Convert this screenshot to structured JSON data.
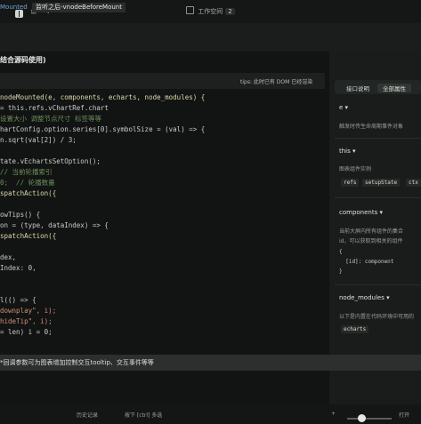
{
  "window": {
    "title": "工作空间",
    "badge": "2"
  },
  "toolbar": {
    "list_icon": "≡",
    "back_icon": "‹"
  },
  "heading": "结合源码使用)",
  "editor": {
    "tab_a": "Mounted",
    "tab_b": "监听之后-vnodeBeforeMount",
    "tip": "tips: 此时已有 DOM 已经渲染"
  },
  "code_lines": [
    {
      "p": "nodeMounted(e, components, echarts, node_modules) {",
      "c": "fn"
    },
    {
      "p": "= this.refs.vChartRef.chart",
      "c": ""
    },
    {
      "p": "设置大小 调整节点尺寸 标签等等",
      "c": "cm"
    },
    {
      "p": "hartConfig.option.series[0].symbolSize = (val) => {",
      "c": ""
    },
    {
      "p": "n.sqrt(val[2]) / 3;",
      "c": ""
    },
    {
      "p": "",
      "c": ""
    },
    {
      "p": "tate.vEchartsSetOption();",
      "c": ""
    },
    {
      "p": "// 当前轮播索引",
      "c": "cm"
    },
    {
      "p": "0;  // 轮播数量",
      "c": "cm"
    },
    {
      "p": "spatchAction({",
      "c": "fn"
    },
    {
      "p": "",
      "c": ""
    },
    {
      "p": "owTips() {",
      "c": ""
    },
    {
      "p": "on = (type, dataIndex) => {",
      "c": ""
    },
    {
      "p": "spatchAction({",
      "c": "fn"
    },
    {
      "p": "",
      "c": ""
    },
    {
      "p": "dex,",
      "c": ""
    },
    {
      "p": "Index: 0,",
      "c": ""
    },
    {
      "p": "",
      "c": ""
    },
    {
      "p": "",
      "c": ""
    },
    {
      "p": "l(() => {",
      "c": ""
    },
    {
      "p": "downplay\", i);",
      "c": "st"
    },
    {
      "p": "hideTip\", i);",
      "c": "st"
    },
    {
      "p": "= len) i = 0;",
      "c": ""
    }
  ],
  "panel": {
    "tab_a": "接口说明",
    "tab_b": "全部属性",
    "e": {
      "title": "e ▾",
      "desc": "触发时传生命周期事件对象"
    },
    "this": {
      "title": "this ▾",
      "desc": "图表组件实例",
      "chips": [
        "refs",
        "setupState",
        "ctx"
      ]
    },
    "components": {
      "title": "components ▾",
      "desc1": "当前大屏内所有组件的集合",
      "desc2": "id，可以获取到相关的组件",
      "code1": "{",
      "code2": "  [id]: component",
      "code3": "}"
    },
    "node_modules": {
      "title": "node_modules ▾",
      "desc": "以下是内置在代码环境中可用的",
      "chips": [
        "echarts"
      ]
    }
  },
  "notice": "*回调参数可为图表增加控制交互tooltip、交互事件等等",
  "status": {
    "a": "历史记录",
    "b": "按下 [ctrl] 多选",
    "c": "+",
    "d": "打开"
  }
}
